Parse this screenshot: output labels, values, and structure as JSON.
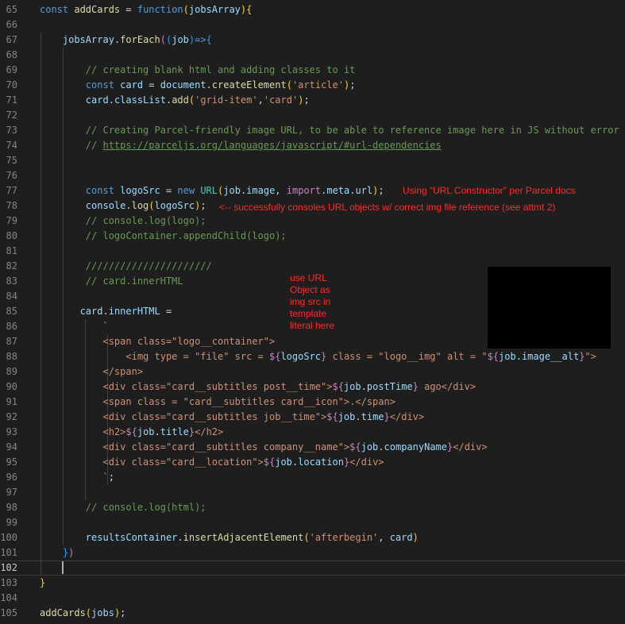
{
  "current_line": 102,
  "lines": [
    {
      "n": 65,
      "tokens": [
        [
          "kw",
          "const "
        ],
        [
          "fn",
          "addCards"
        ],
        [
          "pl",
          " = "
        ],
        [
          "kw",
          "function"
        ],
        [
          "br1",
          "("
        ],
        [
          "var",
          "jobsArray"
        ],
        [
          "br1",
          ")"
        ],
        [
          "br1",
          "{"
        ]
      ]
    },
    {
      "n": 66,
      "tokens": []
    },
    {
      "n": 67,
      "tokens": [
        [
          "pl",
          "    "
        ],
        [
          "var",
          "jobsArray"
        ],
        [
          "pl",
          "."
        ],
        [
          "fn",
          "forEach"
        ],
        [
          "br2",
          "("
        ],
        [
          "br3",
          "("
        ],
        [
          "var",
          "job"
        ],
        [
          "br3",
          ")"
        ],
        [
          "kw",
          "=>"
        ],
        [
          "br3",
          "{"
        ]
      ]
    },
    {
      "n": 68,
      "tokens": []
    },
    {
      "n": 69,
      "tokens": [
        [
          "pl",
          "        "
        ],
        [
          "cm",
          "// creating blank html and adding classes to it"
        ]
      ]
    },
    {
      "n": 70,
      "tokens": [
        [
          "pl",
          "        "
        ],
        [
          "kw",
          "const "
        ],
        [
          "var",
          "card"
        ],
        [
          "pl",
          " = "
        ],
        [
          "var",
          "document"
        ],
        [
          "pl",
          "."
        ],
        [
          "fn",
          "createElement"
        ],
        [
          "br1",
          "("
        ],
        [
          "str",
          "'article'"
        ],
        [
          "br1",
          ")"
        ],
        [
          "pl",
          ";"
        ]
      ]
    },
    {
      "n": 71,
      "tokens": [
        [
          "pl",
          "        "
        ],
        [
          "var",
          "card"
        ],
        [
          "pl",
          "."
        ],
        [
          "var",
          "classList"
        ],
        [
          "pl",
          "."
        ],
        [
          "fn",
          "add"
        ],
        [
          "br1",
          "("
        ],
        [
          "str",
          "'grid-item'"
        ],
        [
          "pl",
          ","
        ],
        [
          "str",
          "'card'"
        ],
        [
          "br1",
          ")"
        ],
        [
          "pl",
          ";"
        ]
      ]
    },
    {
      "n": 72,
      "tokens": []
    },
    {
      "n": 73,
      "tokens": [
        [
          "pl",
          "        "
        ],
        [
          "cm",
          "// Creating Parcel-friendly image URL, to be able to reference image here in JS without error"
        ]
      ]
    },
    {
      "n": 74,
      "tokens": [
        [
          "pl",
          "        "
        ],
        [
          "cm",
          "// "
        ],
        [
          "cmu",
          "https://parceljs.org/languages/javascript/#url-dependencies"
        ]
      ]
    },
    {
      "n": 75,
      "tokens": []
    },
    {
      "n": 76,
      "tokens": []
    },
    {
      "n": 77,
      "tokens": [
        [
          "pl",
          "        "
        ],
        [
          "kw",
          "const "
        ],
        [
          "var",
          "logoSrc"
        ],
        [
          "pl",
          " = "
        ],
        [
          "kw",
          "new "
        ],
        [
          "ty",
          "URL"
        ],
        [
          "br1",
          "("
        ],
        [
          "var",
          "job"
        ],
        [
          "pl",
          "."
        ],
        [
          "var",
          "image"
        ],
        [
          "pl",
          ", "
        ],
        [
          "ctl",
          "import"
        ],
        [
          "pl",
          "."
        ],
        [
          "var",
          "meta"
        ],
        [
          "pl",
          "."
        ],
        [
          "var",
          "url"
        ],
        [
          "br1",
          ")"
        ],
        [
          "pl",
          ";"
        ]
      ]
    },
    {
      "n": 78,
      "tokens": [
        [
          "pl",
          "        "
        ],
        [
          "var",
          "console"
        ],
        [
          "pl",
          "."
        ],
        [
          "fn",
          "log"
        ],
        [
          "br1",
          "("
        ],
        [
          "var",
          "logoSrc"
        ],
        [
          "br1",
          ")"
        ],
        [
          "pl",
          ";"
        ]
      ]
    },
    {
      "n": 79,
      "tokens": [
        [
          "pl",
          "        "
        ],
        [
          "cm",
          "// console.log(logo);"
        ]
      ]
    },
    {
      "n": 80,
      "tokens": [
        [
          "pl",
          "        "
        ],
        [
          "cm",
          "// logoContainer.appendChild(logo);"
        ]
      ]
    },
    {
      "n": 81,
      "tokens": []
    },
    {
      "n": 82,
      "tokens": [
        [
          "pl",
          "        "
        ],
        [
          "cm",
          "//////////////////////"
        ]
      ]
    },
    {
      "n": 83,
      "tokens": [
        [
          "pl",
          "        "
        ],
        [
          "cm",
          "// card.innerHTML"
        ]
      ]
    },
    {
      "n": 84,
      "tokens": []
    },
    {
      "n": 85,
      "tokens": [
        [
          "pl",
          "       "
        ],
        [
          "var",
          "card"
        ],
        [
          "pl",
          "."
        ],
        [
          "var",
          "innerHTML"
        ],
        [
          "pl",
          " ="
        ]
      ]
    },
    {
      "n": 86,
      "tokens": [
        [
          "pl",
          "           "
        ],
        [
          "str",
          "`"
        ]
      ]
    },
    {
      "n": 87,
      "tokens": [
        [
          "pl",
          "           "
        ],
        [
          "str",
          "<span class=\"logo__container\">"
        ]
      ]
    },
    {
      "n": 88,
      "tokens": [
        [
          "pl",
          "               "
        ],
        [
          "str",
          "<img type = \"file\" src = "
        ],
        [
          "ctl",
          "${"
        ],
        [
          "var",
          "logoSrc"
        ],
        [
          "ctl",
          "}"
        ],
        [
          "str",
          " class = \"logo__img\" alt = \""
        ],
        [
          "ctl",
          "${"
        ],
        [
          "var",
          "job"
        ],
        [
          "pl",
          "."
        ],
        [
          "var",
          "image__alt"
        ],
        [
          "ctl",
          "}"
        ],
        [
          "str",
          "\">"
        ]
      ]
    },
    {
      "n": 89,
      "tokens": [
        [
          "pl",
          "           "
        ],
        [
          "str",
          "</span>"
        ]
      ]
    },
    {
      "n": 90,
      "tokens": [
        [
          "pl",
          "           "
        ],
        [
          "str",
          "<div class=\"card__subtitles post__time\">"
        ],
        [
          "ctl",
          "${"
        ],
        [
          "var",
          "job"
        ],
        [
          "pl",
          "."
        ],
        [
          "var",
          "postTime"
        ],
        [
          "ctl",
          "}"
        ],
        [
          "str",
          " ago</div>"
        ]
      ]
    },
    {
      "n": 91,
      "tokens": [
        [
          "pl",
          "           "
        ],
        [
          "str",
          "<span class = \"card__subtitles card__icon\">.</span>"
        ]
      ]
    },
    {
      "n": 92,
      "tokens": [
        [
          "pl",
          "           "
        ],
        [
          "str",
          "<div class=\"card__subtitles job__time\">"
        ],
        [
          "ctl",
          "${"
        ],
        [
          "var",
          "job"
        ],
        [
          "pl",
          "."
        ],
        [
          "var",
          "time"
        ],
        [
          "ctl",
          "}"
        ],
        [
          "str",
          "</div>"
        ]
      ]
    },
    {
      "n": 93,
      "tokens": [
        [
          "pl",
          "           "
        ],
        [
          "str",
          "<h2>"
        ],
        [
          "ctl",
          "${"
        ],
        [
          "var",
          "job"
        ],
        [
          "pl",
          "."
        ],
        [
          "var",
          "title"
        ],
        [
          "ctl",
          "}"
        ],
        [
          "str",
          "</h2>"
        ]
      ]
    },
    {
      "n": 94,
      "tokens": [
        [
          "pl",
          "           "
        ],
        [
          "str",
          "<div class=\"card__subtitles company__name\">"
        ],
        [
          "ctl",
          "${"
        ],
        [
          "var",
          "job"
        ],
        [
          "pl",
          "."
        ],
        [
          "var",
          "companyName"
        ],
        [
          "ctl",
          "}"
        ],
        [
          "str",
          "</div>"
        ]
      ]
    },
    {
      "n": 95,
      "tokens": [
        [
          "pl",
          "           "
        ],
        [
          "str",
          "<div class=\"card__location\">"
        ],
        [
          "ctl",
          "${"
        ],
        [
          "var",
          "job"
        ],
        [
          "pl",
          "."
        ],
        [
          "var",
          "location"
        ],
        [
          "ctl",
          "}"
        ],
        [
          "str",
          "</div>"
        ]
      ]
    },
    {
      "n": 96,
      "tokens": [
        [
          "pl",
          "           "
        ],
        [
          "str",
          "`"
        ],
        [
          "pl",
          ";"
        ]
      ]
    },
    {
      "n": 97,
      "tokens": []
    },
    {
      "n": 98,
      "tokens": [
        [
          "pl",
          "        "
        ],
        [
          "cm",
          "// console.log(html);"
        ]
      ]
    },
    {
      "n": 99,
      "tokens": []
    },
    {
      "n": 100,
      "tokens": [
        [
          "pl",
          "        "
        ],
        [
          "var",
          "resultsContainer"
        ],
        [
          "pl",
          "."
        ],
        [
          "fn",
          "insertAdjacentElement"
        ],
        [
          "br1",
          "("
        ],
        [
          "str",
          "'afterbegin'"
        ],
        [
          "pl",
          ", "
        ],
        [
          "var",
          "card"
        ],
        [
          "br1",
          ")"
        ]
      ]
    },
    {
      "n": 101,
      "tokens": [
        [
          "pl",
          "    "
        ],
        [
          "br3",
          "}"
        ],
        [
          "br2",
          ")"
        ]
      ]
    },
    {
      "n": 102,
      "tokens": []
    },
    {
      "n": 103,
      "tokens": [
        [
          "br1",
          "}"
        ]
      ]
    },
    {
      "n": 104,
      "tokens": []
    },
    {
      "n": 105,
      "tokens": [
        [
          "fn",
          "addCards"
        ],
        [
          "br1",
          "("
        ],
        [
          "var",
          "jobs"
        ],
        [
          "br1",
          ")"
        ],
        [
          "pl",
          ";"
        ]
      ]
    }
  ],
  "annotations": {
    "url_constructor": "Using “URL Constructor” per Parcel docs",
    "console_success": "<-- successfully consoles URL objects w/ correct img file reference (see attmt 2)",
    "use_url_object": "use URL Object as img src in template literal here"
  },
  "colors": {
    "background": "#1e1e1e",
    "keyword": "#569cd6",
    "function": "#dcdcaa",
    "variable": "#9cdcfe",
    "string": "#ce9178",
    "comment": "#6a9955",
    "annotation": "#ff2a2a"
  }
}
